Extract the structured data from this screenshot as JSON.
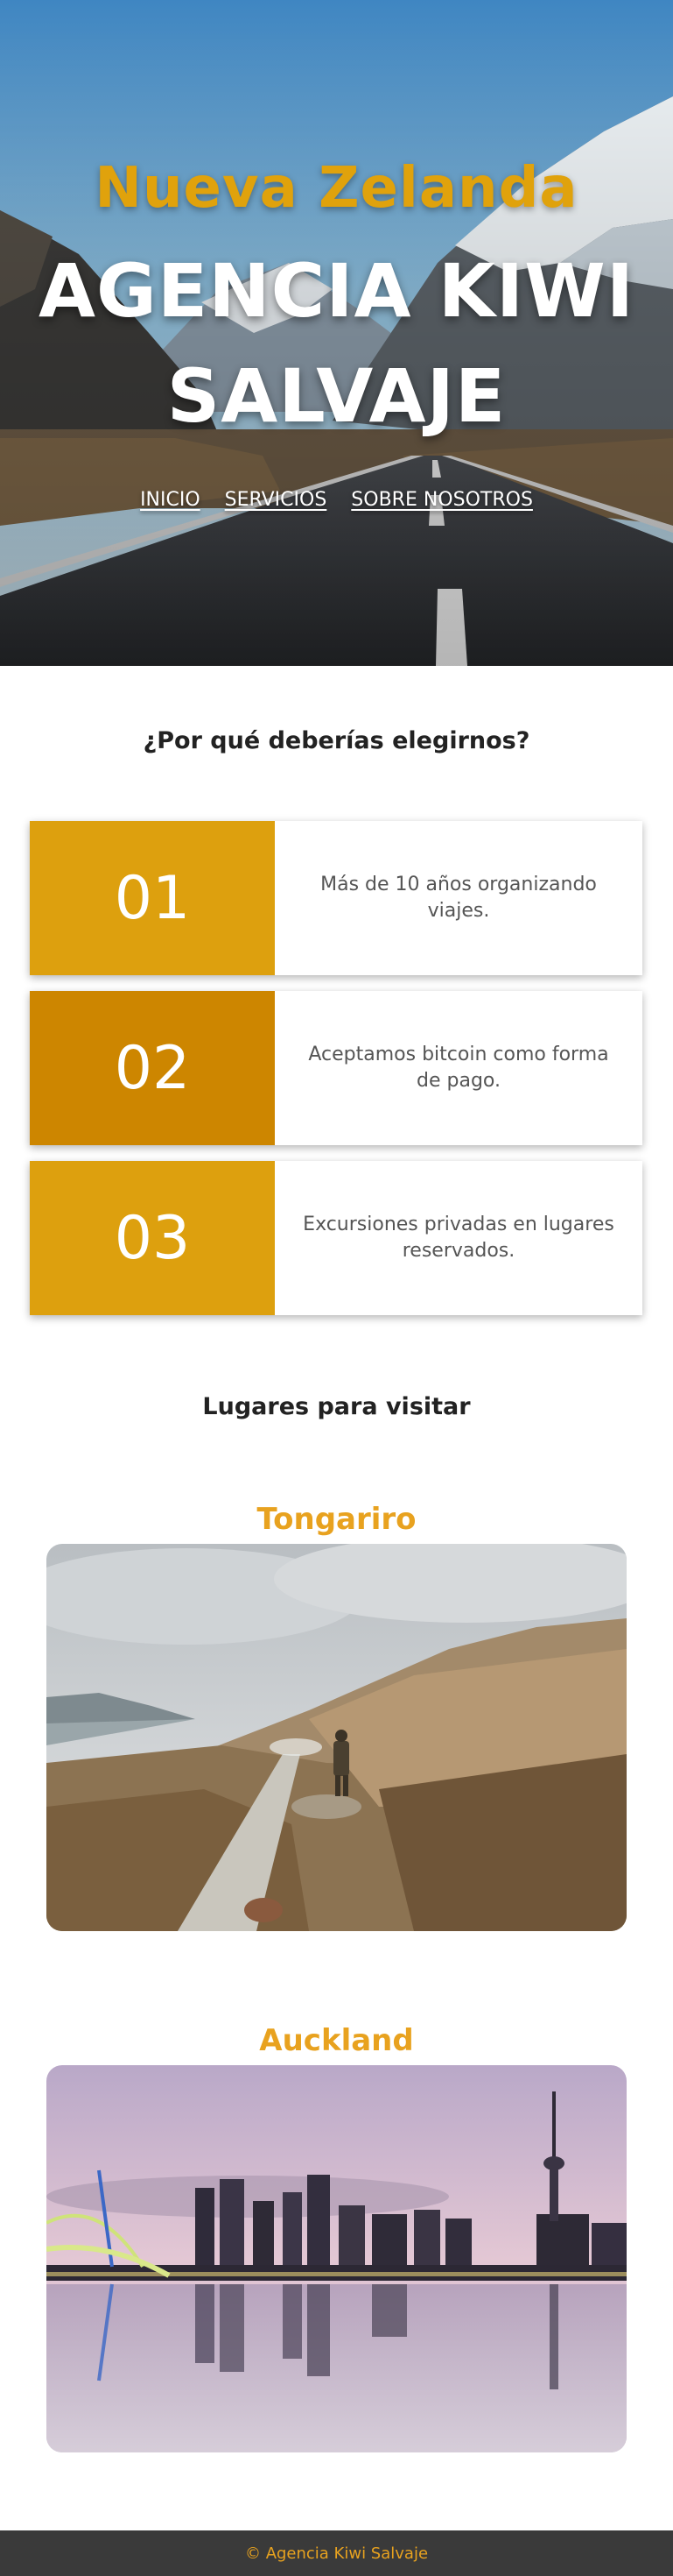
{
  "hero": {
    "subtitle": "Nueva Zelanda",
    "title_line1": "AGENCIA KIWI",
    "title_line2": "SALVAJE",
    "nav": [
      {
        "label": "INICIO"
      },
      {
        "label": "SERVICIOS"
      },
      {
        "label": "SOBRE NOSOTROS"
      }
    ]
  },
  "why": {
    "heading": "¿Por qué deberías elegirnos?",
    "items": [
      {
        "number": "01",
        "text": "Más de 10 años organizando viajes.",
        "color": "#dda00e"
      },
      {
        "number": "02",
        "text": "Aceptamos bitcoin como forma de pago.",
        "color": "#cd8600"
      },
      {
        "number": "03",
        "text": "Excursiones privadas en lugares reservados.",
        "color": "#dda00e"
      }
    ]
  },
  "places": {
    "heading": "Lugares para visitar",
    "items": [
      {
        "name": "Tongariro",
        "image_icon": "mountain-trail-photo"
      },
      {
        "name": "Auckland",
        "image_icon": "city-skyline-photo"
      }
    ]
  },
  "footer": {
    "text": "© Agencia Kiwi Salvaje"
  },
  "colors": {
    "accent": "#e8a21f",
    "footer_bg": "#3a3a3a"
  }
}
